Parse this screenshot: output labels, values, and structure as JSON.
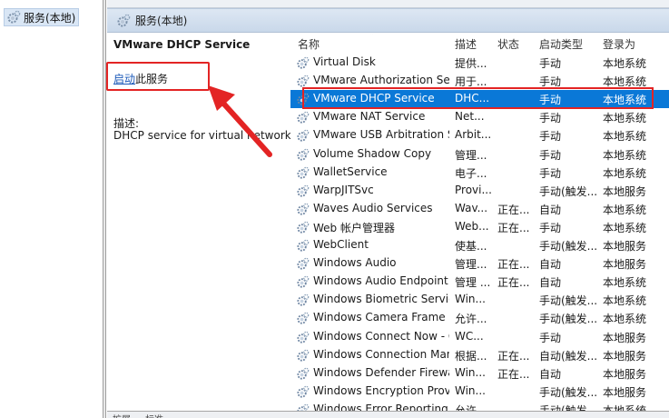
{
  "tree": {
    "item_label": "服务(本地)"
  },
  "header": {
    "title": "服务(本地)"
  },
  "description": {
    "service_name": "VMware DHCP Service",
    "start_link": "启动",
    "start_suffix": "此服务",
    "desc_label": "描述:",
    "desc_text": "DHCP service for virtual networks."
  },
  "columns": [
    "名称",
    "描述",
    "状态",
    "启动类型",
    "登录为"
  ],
  "rows": [
    {
      "name": "Virtual Disk",
      "desc": "提供...",
      "status": "",
      "startup": "手动",
      "logon": "本地系统"
    },
    {
      "name": "VMware Authorization Ser...",
      "desc": "用于...",
      "status": "",
      "startup": "手动",
      "logon": "本地系统"
    },
    {
      "name": "VMware DHCP Service",
      "desc": "DHC...",
      "status": "",
      "startup": "手动",
      "logon": "本地系统"
    },
    {
      "name": "VMware NAT Service",
      "desc": "Net...",
      "status": "",
      "startup": "手动",
      "logon": "本地系统"
    },
    {
      "name": "VMware USB Arbitration S...",
      "desc": "Arbit...",
      "status": "",
      "startup": "手动",
      "logon": "本地系统"
    },
    {
      "name": "Volume Shadow Copy",
      "desc": "管理...",
      "status": "",
      "startup": "手动",
      "logon": "本地系统"
    },
    {
      "name": "WalletService",
      "desc": "电子...",
      "status": "",
      "startup": "手动",
      "logon": "本地系统"
    },
    {
      "name": "WarpJITSvc",
      "desc": "Provi...",
      "status": "",
      "startup": "手动(触发...",
      "logon": "本地服务"
    },
    {
      "name": "Waves Audio Services",
      "desc": "Wav...",
      "status": "正在...",
      "startup": "自动",
      "logon": "本地系统"
    },
    {
      "name": "Web 帐户管理器",
      "desc": "Web...",
      "status": "正在...",
      "startup": "手动",
      "logon": "本地系统"
    },
    {
      "name": "WebClient",
      "desc": "使基...",
      "status": "",
      "startup": "手动(触发...",
      "logon": "本地服务"
    },
    {
      "name": "Windows Audio",
      "desc": "管理...",
      "status": "正在...",
      "startup": "自动",
      "logon": "本地服务"
    },
    {
      "name": "Windows Audio Endpoint B...",
      "desc": "管理 ...",
      "status": "正在...",
      "startup": "自动",
      "logon": "本地系统"
    },
    {
      "name": "Windows Biometric Service",
      "desc": "Win...",
      "status": "",
      "startup": "手动(触发...",
      "logon": "本地系统"
    },
    {
      "name": "Windows Camera Frame S...",
      "desc": "允许...",
      "status": "",
      "startup": "手动(触发...",
      "logon": "本地系统"
    },
    {
      "name": "Windows Connect Now - C...",
      "desc": "WC...",
      "status": "",
      "startup": "手动",
      "logon": "本地服务"
    },
    {
      "name": "Windows Connection Man...",
      "desc": "根据...",
      "status": "正在...",
      "startup": "自动(触发...",
      "logon": "本地服务"
    },
    {
      "name": "Windows Defender Firewall",
      "desc": "Win...",
      "status": "正在...",
      "startup": "自动",
      "logon": "本地服务"
    },
    {
      "name": "Windows Encryption Provid...",
      "desc": "Win...",
      "status": "",
      "startup": "手动(触发...",
      "logon": "本地服务"
    },
    {
      "name": "Windows Error Reporting S...",
      "desc": "允许...",
      "status": "",
      "startup": "手动(触发...",
      "logon": "本地系统"
    }
  ],
  "selected_index": 2,
  "bottom_tabs": [
    "扩展",
    "标准"
  ],
  "colors": {
    "selection": "#0a78d7",
    "highlight": "#e32424",
    "link": "#1a58b8"
  }
}
